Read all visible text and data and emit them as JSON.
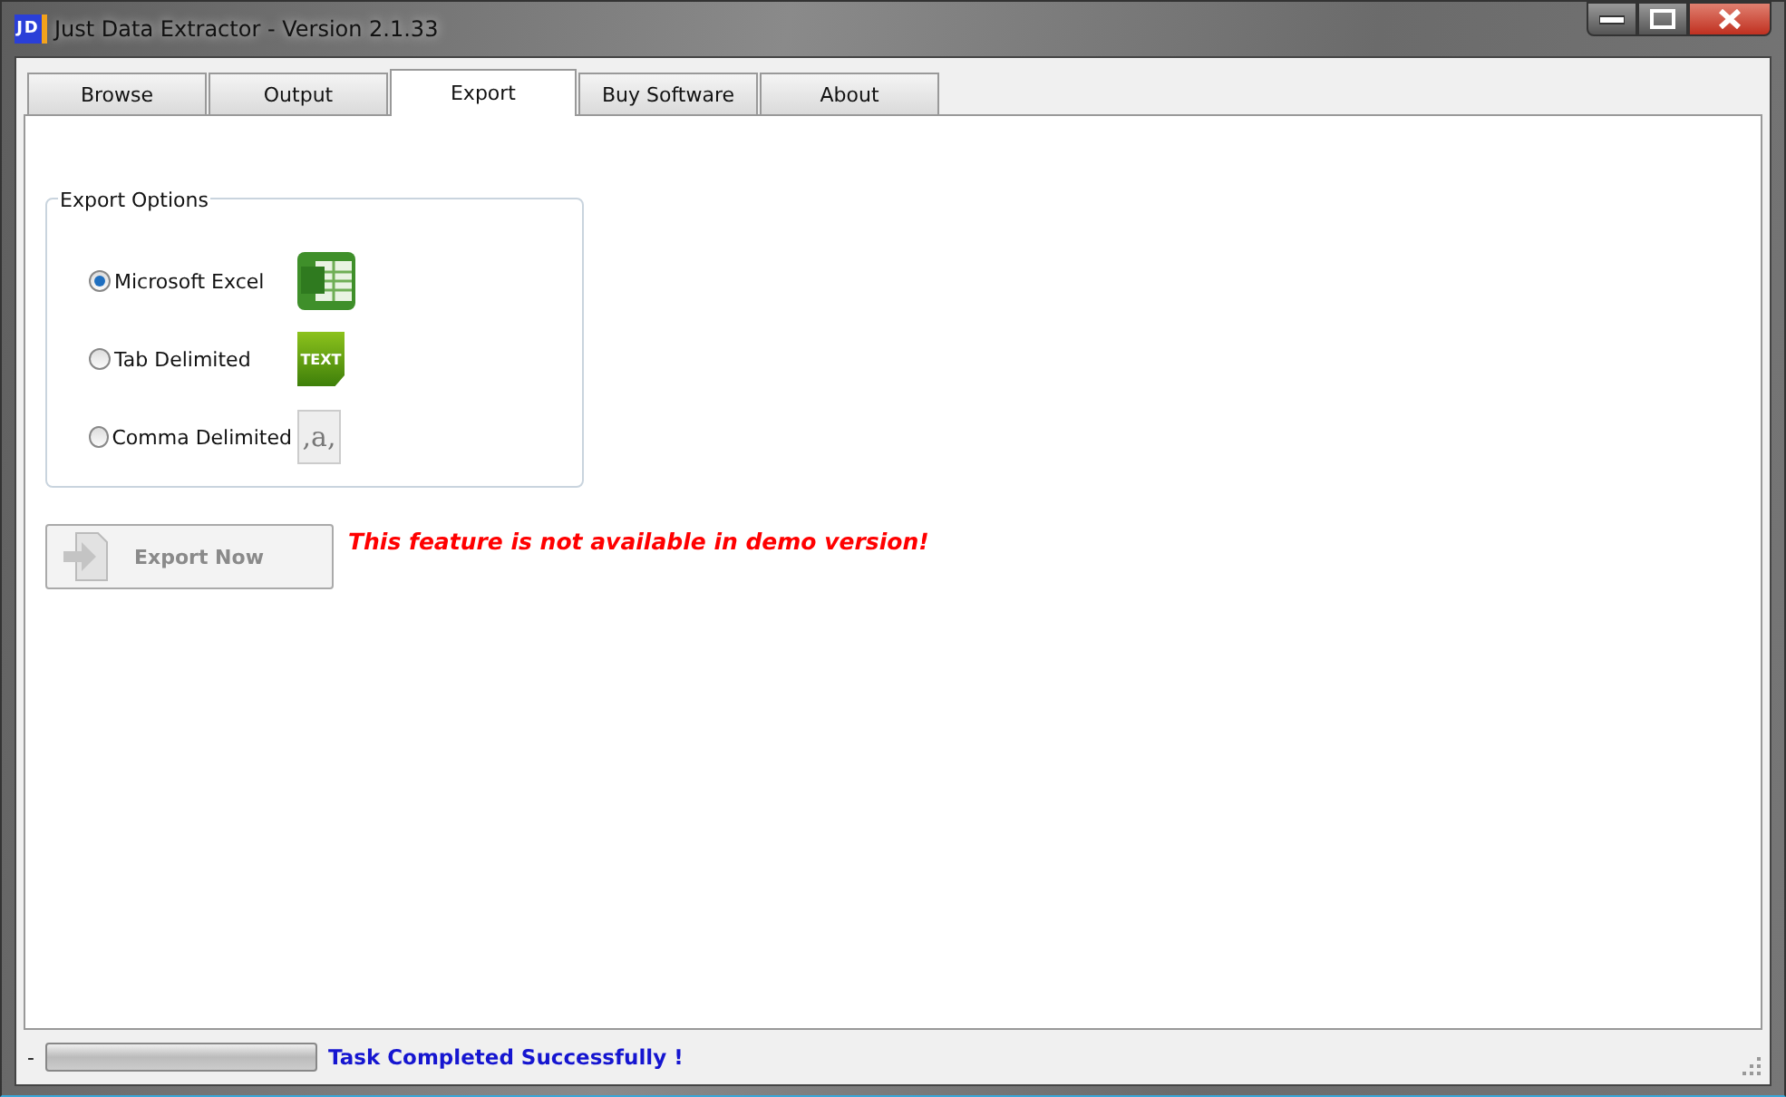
{
  "window": {
    "title": "Just Data Extractor - Version 2.1.33",
    "app_icon_text": "JD"
  },
  "tabs": [
    {
      "label": "Browse",
      "selected": false
    },
    {
      "label": "Output",
      "selected": false
    },
    {
      "label": "Export",
      "selected": true
    },
    {
      "label": "Buy Software",
      "selected": false
    },
    {
      "label": "About",
      "selected": false
    }
  ],
  "export_options": {
    "title": "Export Options",
    "options": [
      {
        "label": "Microsoft Excel",
        "selected": true,
        "kind": "excel"
      },
      {
        "label": "Tab Delimited",
        "selected": false,
        "kind": "text",
        "icon_text": "TEXT"
      },
      {
        "label": "Comma Delimited",
        "selected": false,
        "kind": "comma",
        "icon_text": ",a,"
      }
    ]
  },
  "export_button": {
    "label": "Export Now",
    "disabled": true
  },
  "warning": "This feature is not available in demo version!",
  "status_bar": {
    "prefix": "-",
    "progress": {
      "level": 0
    },
    "message": "Task Completed Successfully !"
  }
}
